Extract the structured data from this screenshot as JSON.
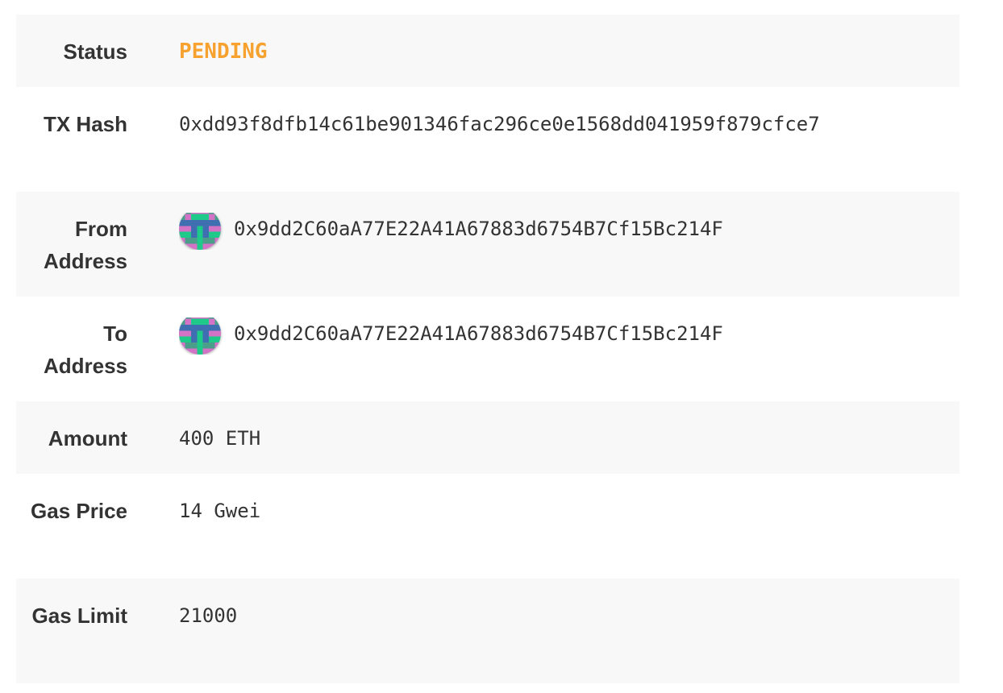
{
  "colors": {
    "status": "#f7a12e",
    "avatar_background": "#4a9e8a",
    "avatar_primary": "#d373c6",
    "avatar_secondary": "#1ec98a",
    "avatar_tertiary": "#3f6fb0"
  },
  "rows": [
    {
      "label": "Status",
      "value": "PENDING"
    },
    {
      "label": "TX Hash",
      "value": "0xdd93f8dfb14c61be901346fac296ce0e1568dd041959f879cfce7"
    },
    {
      "label": "From Address",
      "value": "0x9dd2C60aA77E22A41A67883d6754B7Cf15Bc214F",
      "icon": "identicon-avatar"
    },
    {
      "label": "To Address",
      "value": "0x9dd2C60aA77E22A41A67883d6754B7Cf15Bc214F",
      "icon": "identicon-avatar"
    },
    {
      "label": "Amount",
      "value": "400 ETH"
    },
    {
      "label": "Gas Price",
      "value": "14 Gwei"
    },
    {
      "label": "Gas Limit",
      "value": "21000"
    }
  ]
}
